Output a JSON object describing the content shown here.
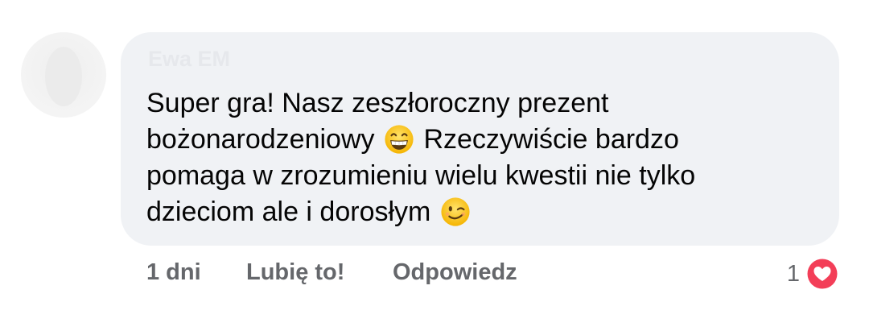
{
  "comment": {
    "author": "Ewa EM",
    "text_lines": [
      "Super gra! Nasz zeszłoroczny prezent",
      "bożonarodzeniowy",
      "Rzeczywiście bardzo",
      "pomaga w zrozumieniu wielu kwestii nie tylko",
      "dzieciom ale i dorosłym"
    ],
    "emojis": [
      "grinning-face-emoji",
      "winking-face-emoji"
    ]
  },
  "actions": {
    "time": "1 dni",
    "like_label": "Lubię to!",
    "reply_label": "Odpowiedz"
  },
  "reactions": {
    "count": "1",
    "icon": "love-heart-icon",
    "color": "#f33e58"
  },
  "colors": {
    "bubble": "#f0f2f5",
    "text": "#050505",
    "secondary": "#65676b"
  }
}
